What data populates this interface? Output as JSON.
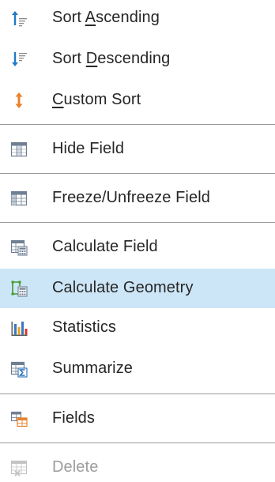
{
  "menu": {
    "items": [
      {
        "pre": "Sort ",
        "key": "A",
        "post": "scending",
        "icon": "sort-ascending-icon"
      },
      {
        "pre": "Sort ",
        "key": "D",
        "post": "escending",
        "icon": "sort-descending-icon"
      },
      {
        "pre": "",
        "key": "C",
        "post": "ustom Sort",
        "icon": "custom-sort-icon"
      },
      {
        "label": "Hide Field",
        "icon": "hide-field-icon"
      },
      {
        "label": "Freeze/Unfreeze Field",
        "icon": "freeze-field-icon"
      },
      {
        "label": "Calculate Field",
        "icon": "calculate-field-icon"
      },
      {
        "label": "Calculate Geometry",
        "icon": "calculate-geometry-icon",
        "state": "highlighted"
      },
      {
        "label": "Statistics",
        "icon": "statistics-icon"
      },
      {
        "label": "Summarize",
        "icon": "summarize-icon"
      },
      {
        "label": "Fields",
        "icon": "fields-icon"
      },
      {
        "label": "Delete",
        "icon": "delete-icon",
        "state": "disabled"
      }
    ]
  },
  "colors": {
    "highlight": "#cde6f7",
    "separator": "#9a9a9a",
    "text": "#262626",
    "disabled_text": "#9d9d9d",
    "arrow_blue": "#1e7bc6",
    "arrow_orange": "#e8812b"
  }
}
